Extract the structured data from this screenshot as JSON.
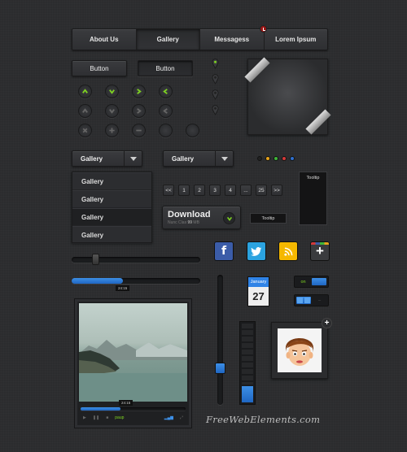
{
  "nav": {
    "items": [
      "About Us",
      "Gallery",
      "Messagess",
      "Lorem Ipsum"
    ],
    "active": "Gallery"
  },
  "buttons": {
    "primary_label": "Button",
    "pressed_label": "Button"
  },
  "icons": {
    "green_row": [
      "chevron-up-icon",
      "chevron-down-icon",
      "chevron-right-icon",
      "chevron-left-icon"
    ],
    "gray_row": [
      "chevron-up-icon",
      "chevron-down-icon",
      "chevron-right-icon",
      "chevron-left-icon"
    ],
    "third_row": [
      "close-icon",
      "plus-icon",
      "minus-icon",
      "blank-circle-icon",
      "blank-circle-icon"
    ],
    "accent": "#7ed321"
  },
  "dropdowns": {
    "primary_value": "Gallery",
    "secondary_value": "Gallery"
  },
  "list": {
    "items": [
      "Gallery",
      "Gallery",
      "Gallery",
      "Gallery"
    ],
    "selected_index": 2
  },
  "color_dots": [
    "#222222",
    "#e8a31a",
    "#3fb53a",
    "#d43a3a",
    "#2f6fcf"
  ],
  "pagination": {
    "pages": [
      "<<",
      "1",
      "2",
      "3",
      "4",
      "...",
      "25",
      ">>"
    ]
  },
  "download": {
    "title": "Download",
    "sub_prefix": "Nunc Clas",
    "sub_count": "99",
    "sub_suffix": "MB"
  },
  "tooltips": {
    "small": "Tooltip",
    "tall": "Tooltip"
  },
  "social": [
    {
      "name": "facebook-icon",
      "glyph": "f",
      "color": "#3b5ca8"
    },
    {
      "name": "twitter-icon",
      "glyph": "t",
      "color": "#2ba3e0"
    },
    {
      "name": "rss-icon",
      "glyph": "rss",
      "color": "#f5b800"
    },
    {
      "name": "plus-icon",
      "glyph": "+",
      "color": "#3a3b3e"
    }
  ],
  "sliders": {
    "top_knob_pct": 17,
    "progress_pct": 40,
    "progress_time": "24:15",
    "vertical_value_pct": 35,
    "meter_fill_pct": 25
  },
  "player": {
    "time": "24:15",
    "progress_pct": 38,
    "label": "paup"
  },
  "calendar": {
    "month": "January",
    "day": "27"
  },
  "toggles": {
    "on_label": "on"
  },
  "brand": "FreeWebElements.com",
  "colors": {
    "blue": "#2f83e6",
    "panel": "#3a3b3e",
    "background": "#2b2c2e"
  }
}
